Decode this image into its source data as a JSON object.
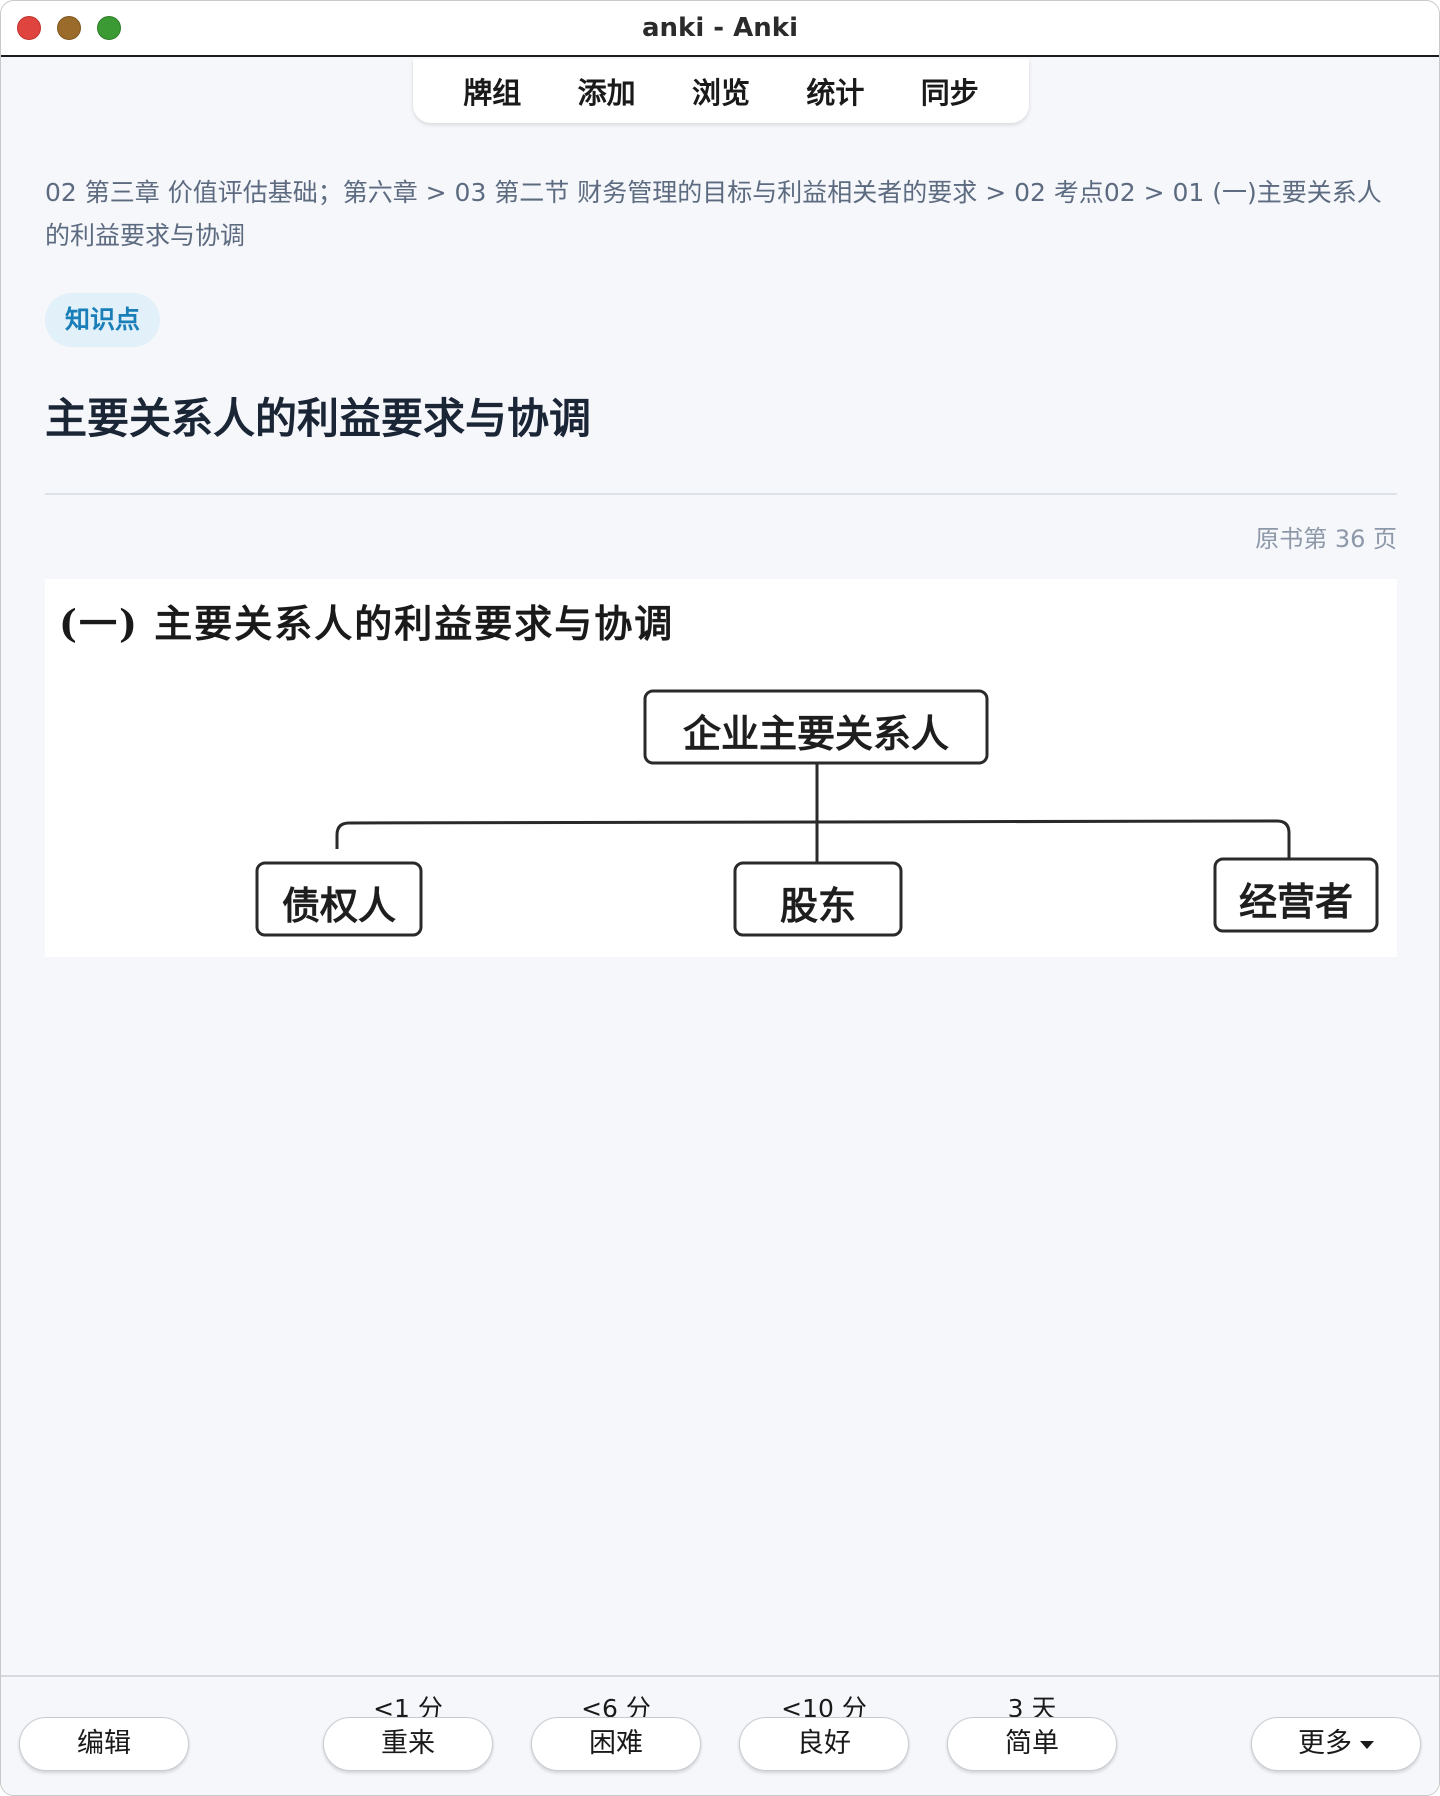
{
  "window": {
    "title": "anki - Anki"
  },
  "toolbar": {
    "items": [
      {
        "label": "牌组"
      },
      {
        "label": "添加"
      },
      {
        "label": "浏览"
      },
      {
        "label": "统计"
      },
      {
        "label": "同步"
      }
    ]
  },
  "card": {
    "breadcrumb": "02 第三章 价值评估基础；第六章 > 03 第二节 财务管理的目标与利益相关者的要求 > 02 考点02 > 01 (一)主要关系人的利益要求与协调",
    "tag": "知识点",
    "title": "主要关系人的利益要求与协调",
    "page_ref": "原书第 36 页",
    "figure": {
      "heading": "(一) 主要关系人的利益要求与协调",
      "root": "企业主要关系人",
      "children": [
        "债权人",
        "股东",
        "经营者"
      ]
    }
  },
  "bottom": {
    "edit_label": "编辑",
    "answers": [
      {
        "interval": "<1 分",
        "label": "重来"
      },
      {
        "interval": "<6 分",
        "label": "困难"
      },
      {
        "interval": "<10 分",
        "label": "良好"
      },
      {
        "interval": "3 天",
        "label": "简单"
      }
    ],
    "more_label": "更多"
  },
  "colors": {
    "accent_tag_bg": "#e2f0f9",
    "accent_tag_text": "#1a7fb8",
    "breadcrumb": "#5d6b80",
    "background": "#f6f7fb"
  }
}
